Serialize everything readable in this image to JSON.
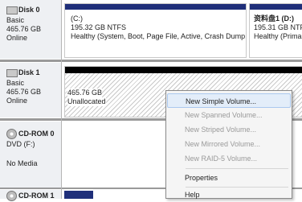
{
  "disks": [
    {
      "name": "Disk 0",
      "type": "Basic",
      "size": "465.76 GB",
      "status": "Online"
    },
    {
      "name": "Disk 1",
      "type": "Basic",
      "size": "465.76 GB",
      "status": "Online"
    },
    {
      "name": "CD-ROM 0",
      "type": "DVD (F:)",
      "status": "No Media"
    },
    {
      "name": "CD-ROM 1"
    }
  ],
  "disk0_partitions": [
    {
      "label": "(C:)",
      "size": "195.32 GB NTFS",
      "status": "Healthy (System, Boot, Page File, Active, Crash Dump, Prir"
    },
    {
      "label": "资料盘1 (D:)",
      "size": "195.31 GB NTFS",
      "status": "Healthy (Primar"
    }
  ],
  "disk1_unallocated": {
    "size": "465.76 GB",
    "status": "Unallocated"
  },
  "context_menu": [
    {
      "label": "New Simple Volume...",
      "enabled": true,
      "highlighted": true
    },
    {
      "label": "New Spanned Volume...",
      "enabled": false
    },
    {
      "label": "New Striped Volume...",
      "enabled": false
    },
    {
      "label": "New Mirrored Volume...",
      "enabled": false
    },
    {
      "label": "New RAID-5 Volume...",
      "enabled": false
    },
    {
      "label": "Properties",
      "enabled": true
    },
    {
      "label": "Help",
      "enabled": true
    }
  ],
  "colors": {
    "primary_partition_bar": "#1f2f7a",
    "unallocated_bar": "#000000",
    "highlight": "#e3edf9"
  }
}
